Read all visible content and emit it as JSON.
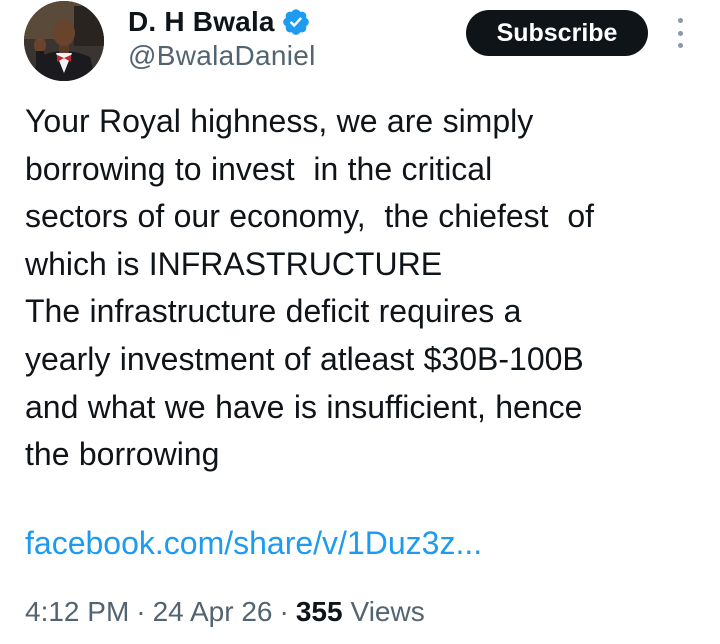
{
  "author": {
    "name": "D. H Bwala",
    "handle": "@BwalaDaniel",
    "verified": true
  },
  "actions": {
    "subscribe_label": "Subscribe",
    "more_icon": "more-vertical-icon"
  },
  "tweet": {
    "text": "Your Royal highness, we are simply\nborrowing to invest  in the critical\nsectors of our economy,  the chiefest  of\nwhich is INFRASTRUCTURE\nThe infrastructure deficit requires a\nyearly investment of atleast $30B-100B\nand what we have is insufficient, hence\nthe borrowing",
    "link": "facebook.com/share/v/1Duz3z..."
  },
  "meta": {
    "time": "4:12 PM",
    "date": "24 Apr 26",
    "separator": "·",
    "views_count": "355",
    "views_label": "Views"
  },
  "colors": {
    "link": "#1d9bf0",
    "verified": "#1d9bf0",
    "secondary_text": "#536471",
    "button_bg": "#0f1419"
  }
}
